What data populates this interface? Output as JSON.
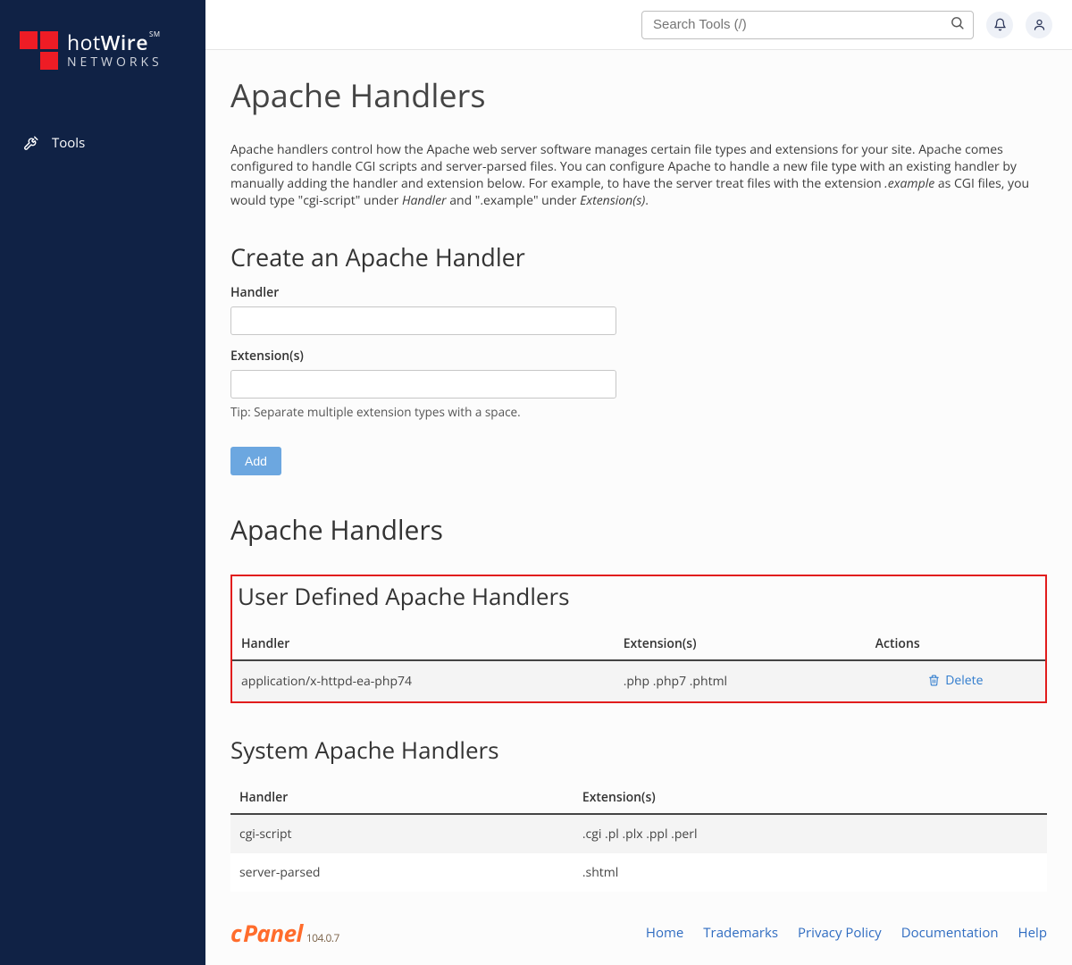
{
  "brand": {
    "name_prefix": "hot",
    "name_bold": "Wire",
    "sm": "SM",
    "sub": "NETWORKS"
  },
  "nav": {
    "tools": "Tools"
  },
  "search": {
    "placeholder": "Search Tools (/)"
  },
  "page": {
    "title": "Apache Handlers",
    "intro_pre": "Apache handlers control how the Apache web server software manages certain file types and extensions for your site. Apache comes configured to handle CGI scripts and server-parsed files. You can configure Apache to handle a new file type with an existing handler by manually adding the handler and extension below. For example, to have the server treat files with the extension ",
    "intro_em1": ".example",
    "intro_mid": " as CGI files, you would type \"cgi-script\" under ",
    "intro_em2": "Handler",
    "intro_mid2": " and \".example\" under ",
    "intro_em3": "Extension(s)",
    "intro_end": "."
  },
  "create": {
    "heading": "Create an Apache Handler",
    "handler_label": "Handler",
    "ext_label": "Extension(s)",
    "tip": "Tip: Separate multiple extension types with a space.",
    "add_label": "Add"
  },
  "list_heading": "Apache Handlers",
  "user_table": {
    "heading": "User Defined Apache Handlers",
    "cols": {
      "handler": "Handler",
      "ext": "Extension(s)",
      "actions": "Actions"
    },
    "rows": [
      {
        "handler": "application/x-httpd-ea-php74",
        "ext": ".php .php7 .phtml",
        "action": "Delete"
      }
    ]
  },
  "system_table": {
    "heading": "System Apache Handlers",
    "cols": {
      "handler": "Handler",
      "ext": "Extension(s)"
    },
    "rows": [
      {
        "handler": "cgi-script",
        "ext": ".cgi .pl .plx .ppl .perl"
      },
      {
        "handler": "server-parsed",
        "ext": ".shtml"
      }
    ]
  },
  "footer": {
    "cpanel_c": "c",
    "cpanel_rest": "Panel",
    "version": "104.0.7",
    "links": [
      "Home",
      "Trademarks",
      "Privacy Policy",
      "Documentation",
      "Help"
    ]
  }
}
